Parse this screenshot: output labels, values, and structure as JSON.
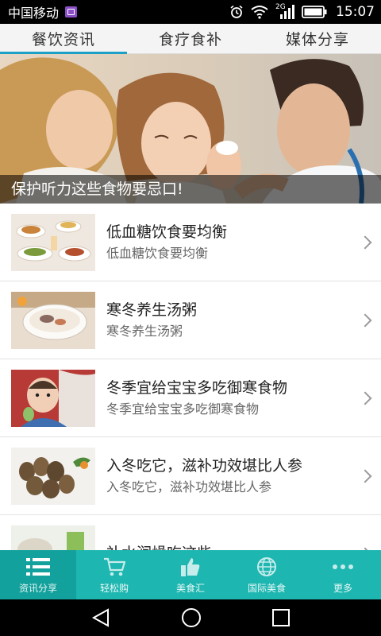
{
  "status_bar": {
    "carrier": "中国移动",
    "network": "2G",
    "time": "15:07"
  },
  "tabs": [
    {
      "label": "餐饮资讯",
      "active": true
    },
    {
      "label": "食疗食补",
      "active": false
    },
    {
      "label": "媒体分享",
      "active": false
    }
  ],
  "hero": {
    "caption": "保护听力这些食物要忌口!"
  },
  "news": [
    {
      "title": "低血糖饮食要均衡",
      "desc": "低血糖饮食要均衡"
    },
    {
      "title": "寒冬养生汤粥",
      "desc": "寒冬养生汤粥"
    },
    {
      "title": "冬季宜给宝宝多吃御寒食物",
      "desc": "冬季宜给宝宝多吃御寒食物"
    },
    {
      "title": "入冬吃它，滋补功效堪比人参",
      "desc": "入冬吃它，滋补功效堪比人参"
    },
    {
      "title": "补水润燥吃这些",
      "desc": ""
    }
  ],
  "bottom_nav": [
    {
      "label": "资讯分享",
      "icon": "list-icon",
      "active": true
    },
    {
      "label": "轻松购",
      "icon": "cart-icon",
      "active": false
    },
    {
      "label": "美食汇",
      "icon": "thumbs-up-icon",
      "active": false
    },
    {
      "label": "国际美食",
      "icon": "globe-icon",
      "active": false
    },
    {
      "label": "更多",
      "icon": "more-icon",
      "active": false
    }
  ],
  "colors": {
    "tab_indicator": "#1ba0c8",
    "bottom_nav_bg": "#1db6b0",
    "bottom_nav_active_bg": "#12a19c"
  }
}
